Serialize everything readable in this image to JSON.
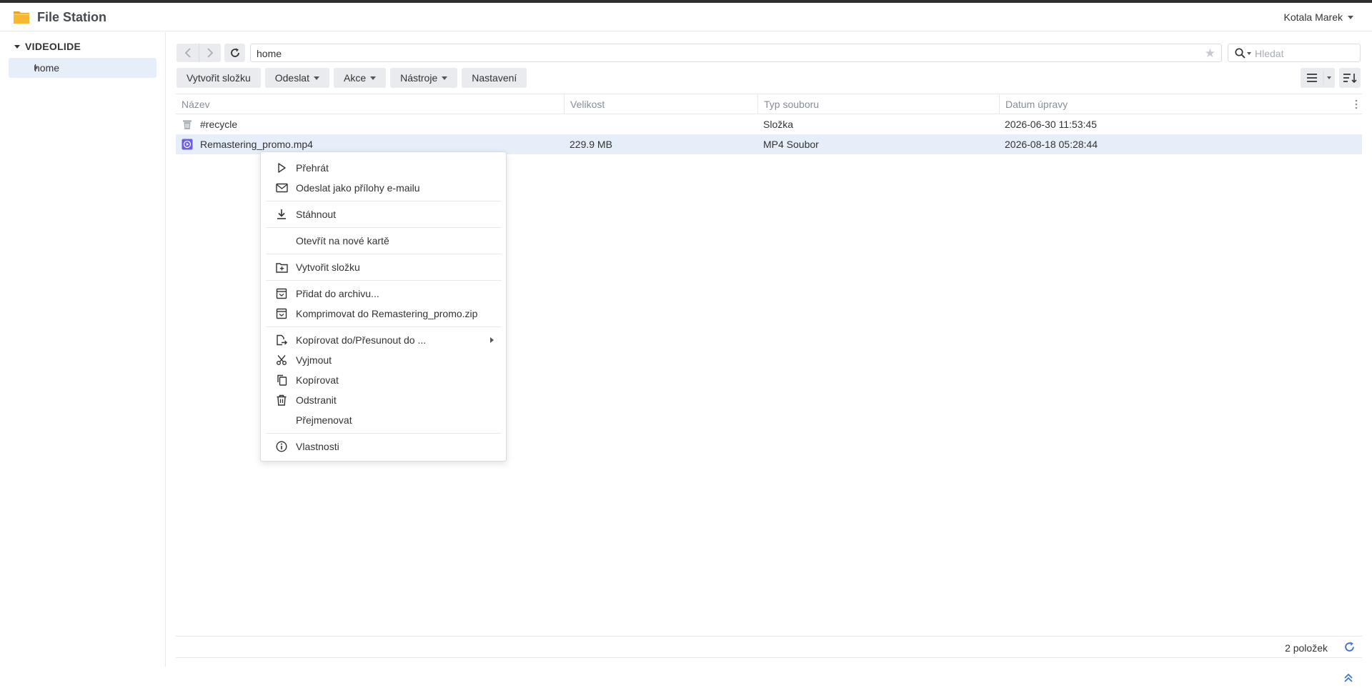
{
  "app": {
    "title": "File Station",
    "user": "Kotala Marek"
  },
  "sidebar": {
    "root": "VIDEOLIDE",
    "items": [
      {
        "label": "home",
        "selected": true
      }
    ]
  },
  "path": {
    "value": "home"
  },
  "search": {
    "placeholder": "Hledat"
  },
  "toolbar": {
    "create_folder": "Vytvořit složku",
    "upload": "Odeslat",
    "action": "Akce",
    "tools": "Nástroje",
    "settings": "Nastavení"
  },
  "grid": {
    "columns": [
      "Název",
      "Velikost",
      "Typ souboru",
      "Datum úpravy"
    ],
    "rows": [
      {
        "name": "#recycle",
        "size": "",
        "type": "Složka",
        "modified": "2026-06-30 11:53:45",
        "icon": "trash-folder-icon",
        "selected": false
      },
      {
        "name": "Remastering_promo.mp4",
        "size": "229.9 MB",
        "type": "MP4 Soubor",
        "modified": "2026-08-18 05:28:44",
        "icon": "video-file-icon",
        "selected": true
      }
    ]
  },
  "footer": {
    "count": "2 položek"
  },
  "context_menu": {
    "items": [
      {
        "label": "Přehrát",
        "icon": "play-icon"
      },
      {
        "label": "Odeslat jako přílohy e-mailu",
        "icon": "mail-icon"
      },
      {
        "label": "Stáhnout",
        "icon": "download-icon"
      },
      {
        "label": "Otevřít na nové kartě",
        "icon": ""
      },
      {
        "label": "Vytvořit složku",
        "icon": "new-folder-icon"
      },
      {
        "label": "Přidat do archivu...",
        "icon": "archive-icon"
      },
      {
        "label": "Komprimovat do Remastering_promo.zip",
        "icon": "archive-icon"
      },
      {
        "label": "Kopírovat do/Přesunout do ...",
        "icon": "copy-move-icon",
        "submenu": true
      },
      {
        "label": "Vyjmout",
        "icon": "scissors-icon"
      },
      {
        "label": "Kopírovat",
        "icon": "copy-icon"
      },
      {
        "label": "Odstranit",
        "icon": "delete-icon"
      },
      {
        "label": "Přejmenovat",
        "icon": ""
      },
      {
        "label": "Vlastnosti",
        "icon": "info-icon"
      }
    ]
  },
  "colors": {
    "accent": "#3d74d7",
    "selected_row": "#e6eef9",
    "button_bg": "#e9ebee",
    "folder": "#f7b731",
    "video_icon": "#6c5ce7"
  }
}
